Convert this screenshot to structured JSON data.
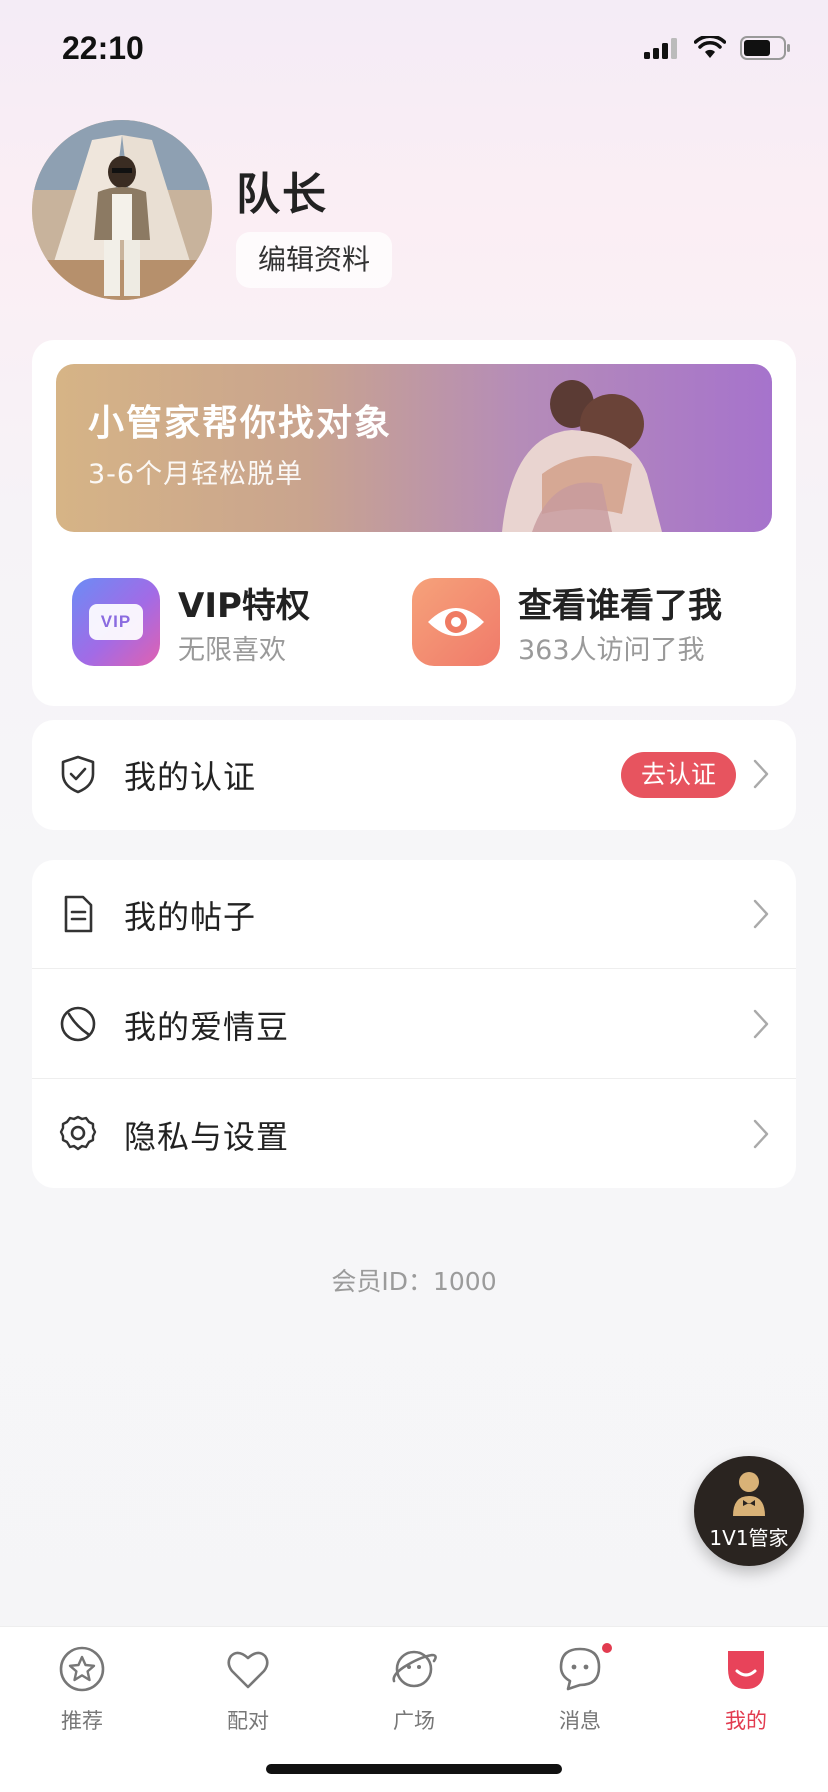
{
  "status_bar": {
    "time": "22:10"
  },
  "profile": {
    "nickname": "队长",
    "edit_label": "编辑资料"
  },
  "banner": {
    "title": "小管家帮你找对象",
    "subtitle": "3-6个月轻松脱单"
  },
  "features": {
    "vip": {
      "icon_text": "VIP",
      "title": "VIP特权",
      "subtitle": "无限喜欢"
    },
    "visitors": {
      "title": "查看谁看了我",
      "subtitle": "363人访问了我"
    }
  },
  "auth": {
    "label": "我的认证",
    "action": "去认证"
  },
  "menu": {
    "posts": "我的帖子",
    "beans": "我的爱情豆",
    "settings": "隐私与设置"
  },
  "member_id": "会员ID：1000",
  "butler": {
    "label": "1V1管家"
  },
  "tabs": [
    {
      "label": "推荐",
      "icon": "star-icon"
    },
    {
      "label": "配对",
      "icon": "heart-icon"
    },
    {
      "label": "广场",
      "icon": "planet-icon"
    },
    {
      "label": "消息",
      "icon": "chat-icon",
      "badge": true
    },
    {
      "label": "我的",
      "icon": "me-icon",
      "active": true
    }
  ],
  "colors": {
    "accent": "#e23b4f",
    "auth_pill": "#e7545f"
  }
}
